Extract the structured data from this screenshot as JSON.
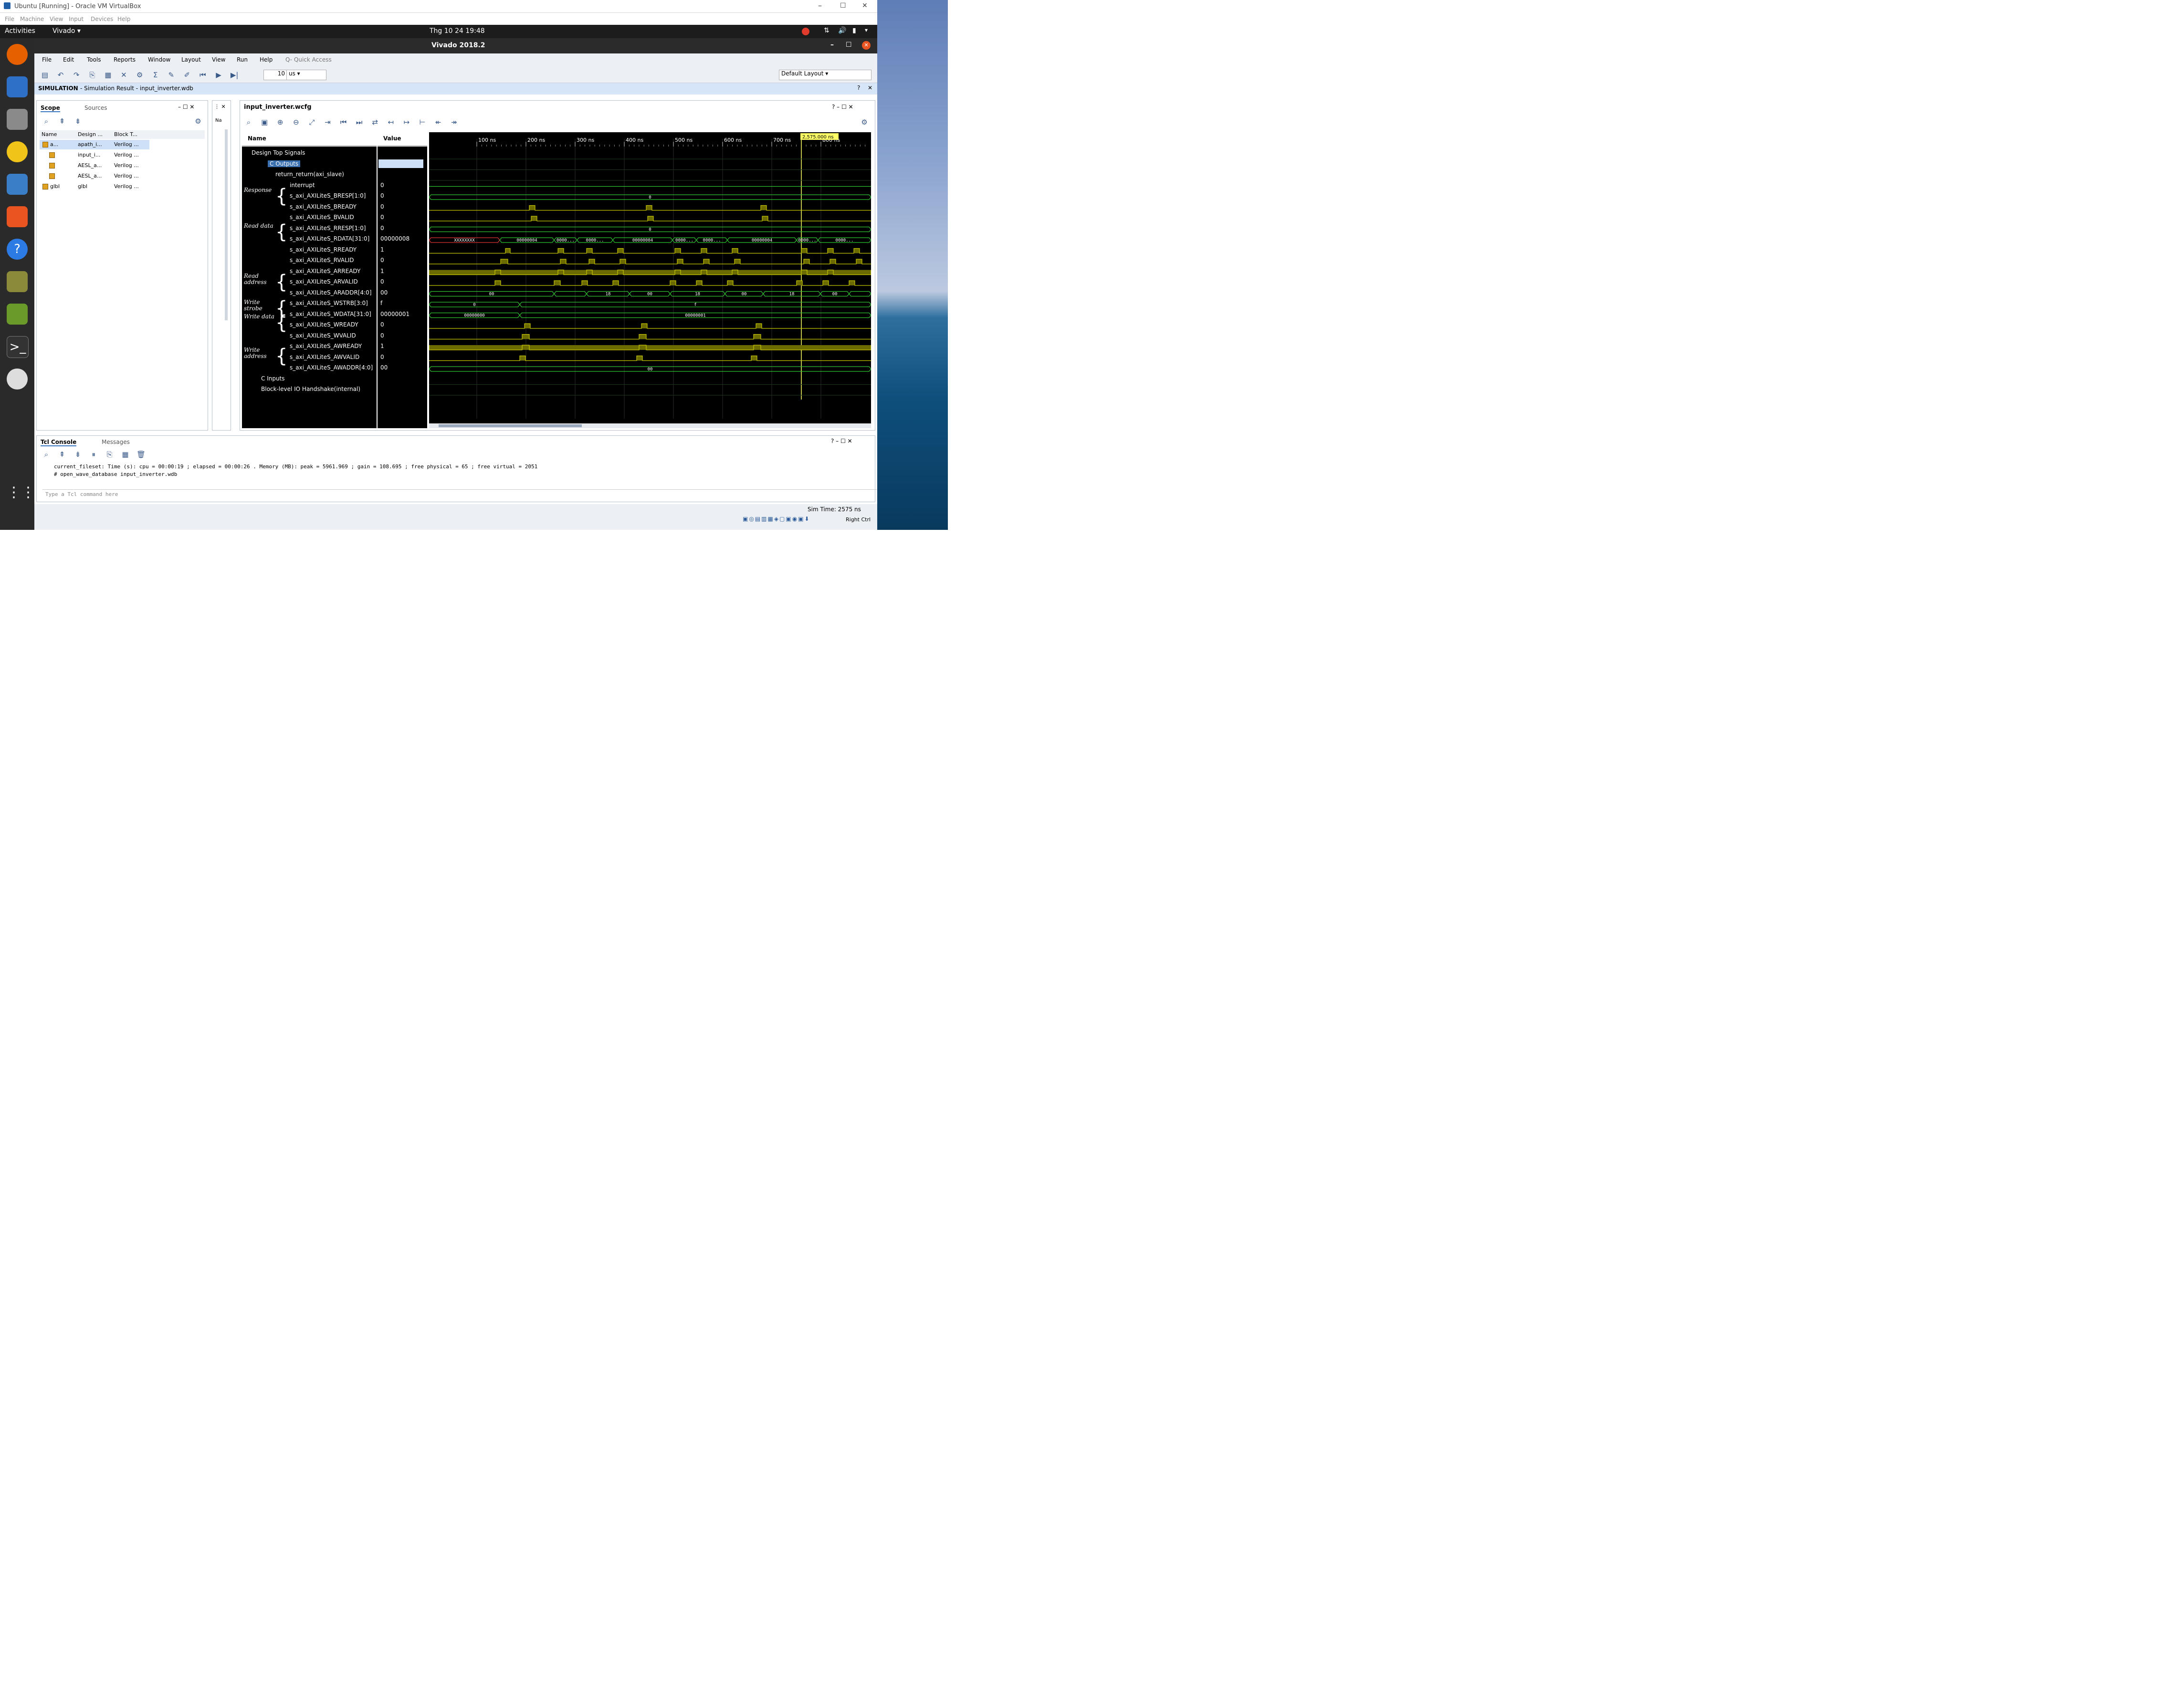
{
  "host": {
    "title": "Ubuntu [Running] - Oracle VM VirtualBox",
    "menu": [
      "File",
      "Machine",
      "View",
      "Input",
      "Devices",
      "Help"
    ],
    "window_controls": [
      "–",
      "☐",
      "✕"
    ]
  },
  "gnome": {
    "activities": "Activities",
    "app": "Vivado ▾",
    "clock": "Thg 10 24  19:48"
  },
  "dock": [
    "firefox-icon",
    "thunderbird-icon",
    "files-icon",
    "rhythmbox-icon",
    "writer-icon",
    "software-icon",
    "help-icon",
    "vivado-icon",
    "xilinx-icon",
    "terminal-icon",
    "dvd-icon",
    "apps-grid-icon"
  ],
  "vivado": {
    "title": "Vivado 2018.2",
    "menu": [
      "File",
      "Edit",
      "Tools",
      "Reports",
      "Window",
      "Layout",
      "View",
      "Run",
      "Help"
    ],
    "quick_access_placeholder": "Q- Quick Access",
    "run_time_value": "10",
    "run_time_unit": "us",
    "layout_select": "Default Layout",
    "sim_banner_bold": "SIMULATION",
    "sim_banner_rest": " - Simulation Result - input_inverter.wdb"
  },
  "scope": {
    "tabs": [
      "Scope",
      "Sources"
    ],
    "columns": [
      "Name",
      "Design ...",
      "Block T..."
    ],
    "rows": [
      {
        "name": "a...",
        "design": "apath_i...",
        "type": "Verilog ...",
        "indent": 0,
        "selected": true
      },
      {
        "name": "",
        "design": "input_i...",
        "type": "Verilog ...",
        "indent": 1,
        "selected": false
      },
      {
        "name": "",
        "design": "AESL_a...",
        "type": "Verilog ...",
        "indent": 1,
        "selected": false
      },
      {
        "name": "",
        "design": "AESL_a...",
        "type": "Verilog ...",
        "indent": 1,
        "selected": false
      },
      {
        "name": "glbl",
        "design": "glbl",
        "type": "Verilog ...",
        "indent": 0,
        "selected": false
      }
    ]
  },
  "objects_strip": {
    "label": "Na"
  },
  "wave": {
    "tab": "input_inverter.wcfg",
    "col_name": "Name",
    "col_value": "Value",
    "marker": "2,575.000 ns",
    "ticks": [
      "100 ns",
      "200 ns",
      "300 ns",
      "400 ns",
      "500 ns",
      "600 ns",
      "700 ns",
      "800 ns"
    ],
    "signals": [
      {
        "name": "Design Top Signals",
        "value": "",
        "group": true
      },
      {
        "name": "C Outputs",
        "value": "",
        "group": true,
        "selected": true
      },
      {
        "name": "return_return(axi_slave)",
        "value": "",
        "group": true
      },
      {
        "name": "interrupt",
        "value": "0"
      },
      {
        "name": "s_axi_AXILiteS_BRESP[1:0]",
        "value": "0"
      },
      {
        "name": "s_axi_AXILiteS_BREADY",
        "value": "0"
      },
      {
        "name": "s_axi_AXILiteS_BVALID",
        "value": "0"
      },
      {
        "name": "s_axi_AXILiteS_RRESP[1:0]",
        "value": "0"
      },
      {
        "name": "s_axi_AXILiteS_RDATA[31:0]",
        "value": "00000008"
      },
      {
        "name": "s_axi_AXILiteS_RREADY",
        "value": "1"
      },
      {
        "name": "s_axi_AXILiteS_RVALID",
        "value": "0"
      },
      {
        "name": "s_axi_AXILiteS_ARREADY",
        "value": "1"
      },
      {
        "name": "s_axi_AXILiteS_ARVALID",
        "value": "0"
      },
      {
        "name": "s_axi_AXILiteS_ARADDR[4:0]",
        "value": "00"
      },
      {
        "name": "s_axi_AXILiteS_WSTRB[3:0]",
        "value": "f"
      },
      {
        "name": "s_axi_AXILiteS_WDATA[31:0]",
        "value": "00000001"
      },
      {
        "name": "s_axi_AXILiteS_WREADY",
        "value": "0"
      },
      {
        "name": "s_axi_AXILiteS_WVALID",
        "value": "0"
      },
      {
        "name": "s_axi_AXILiteS_AWREADY",
        "value": "1"
      },
      {
        "name": "s_axi_AXILiteS_AWVALID",
        "value": "0"
      },
      {
        "name": "s_axi_AXILiteS_AWADDR[4:0]",
        "value": "00"
      },
      {
        "name": "C Inputs",
        "value": "",
        "group": true
      },
      {
        "name": "Block-level IO Handshake(internal)",
        "value": "",
        "group": true
      }
    ],
    "annotations": [
      "Response",
      "Read data",
      "Read address",
      "Write strobe",
      "Write data",
      "Write address"
    ],
    "bus_labels": {
      "rdata": [
        "XXXXXXXX",
        "00000004",
        "0000...",
        "0000...",
        "00000004",
        "0000...",
        "0000...",
        "00000004",
        "0000...",
        "0000..."
      ],
      "araddr": [
        "00",
        "18",
        "00",
        "18",
        "00",
        "18",
        "00"
      ],
      "wstrb": [
        "0",
        "f"
      ],
      "wdata": [
        "00000000",
        "00000001"
      ],
      "bresp": [
        "0"
      ],
      "rresp": [
        "0"
      ],
      "awaddr": [
        "00"
      ]
    }
  },
  "console": {
    "tabs": [
      "Tcl Console",
      "Messages"
    ],
    "lines": [
      "current_fileset: Time (s): cpu = 00:00:19 ; elapsed = 00:00:26 . Memory (MB): peak = 5961.969 ; gain = 108.695 ; free physical = 65 ; free virtual = 2051",
      "# open_wave_database input_inverter.wdb"
    ],
    "input_placeholder": "Type a Tcl command here"
  },
  "status": {
    "sim_time": "Sim Time: 2575 ns",
    "right_ctrl": "Right Ctrl"
  },
  "colors": {
    "wave_high": "#c8c800",
    "wave_bus": "#2fc72f",
    "wave_fill": "#6b6b00",
    "marker": "#ffff66"
  }
}
